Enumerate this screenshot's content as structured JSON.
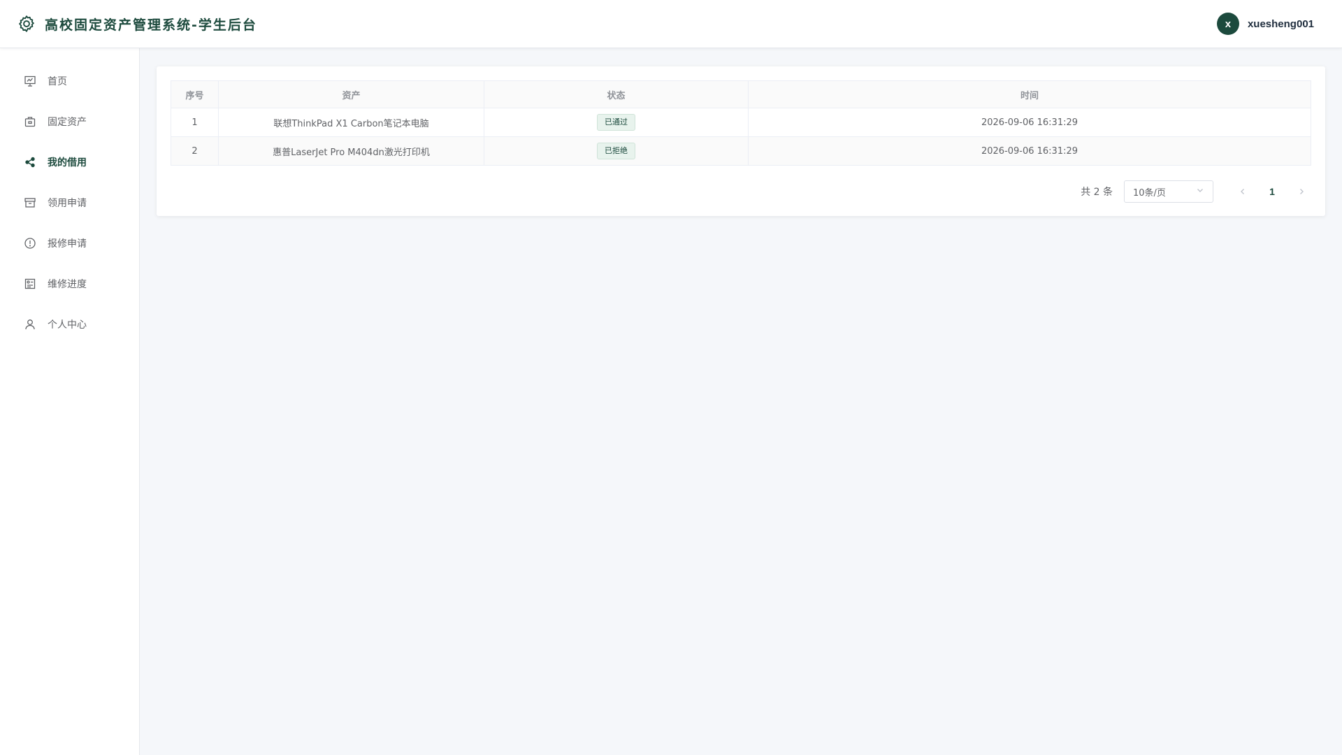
{
  "header": {
    "title": "高校固定资产管理系统-学生后台",
    "avatar_letter": "x",
    "username": "xuesheng001"
  },
  "sidebar": {
    "items": [
      {
        "label": "首页",
        "icon": "presentation-icon",
        "active": false
      },
      {
        "label": "固定资产",
        "icon": "briefcase-icon",
        "active": false
      },
      {
        "label": "我的借用",
        "icon": "share-icon",
        "active": true
      },
      {
        "label": "领用申请",
        "icon": "box-icon",
        "active": false
      },
      {
        "label": "报修申请",
        "icon": "warning-icon",
        "active": false
      },
      {
        "label": "维修进度",
        "icon": "progress-icon",
        "active": false
      },
      {
        "label": "个人中心",
        "icon": "user-icon",
        "active": false
      }
    ]
  },
  "table": {
    "columns": [
      "序号",
      "资产",
      "状态",
      "时间"
    ],
    "rows": [
      {
        "index": "1",
        "asset": "联想ThinkPad X1 Carbon笔记本电脑",
        "status": "已通过",
        "time": "2026-09-06 16:31:29"
      },
      {
        "index": "2",
        "asset": "惠普LaserJet Pro M404dn激光打印机",
        "status": "已拒绝",
        "time": "2026-09-06 16:31:29"
      }
    ]
  },
  "pagination": {
    "total_label": "共 2 条",
    "page_size": "10条/页",
    "current_page": "1"
  },
  "colors": {
    "brand": "#1c4a3d",
    "tag_bg": "#e8f3ed"
  }
}
